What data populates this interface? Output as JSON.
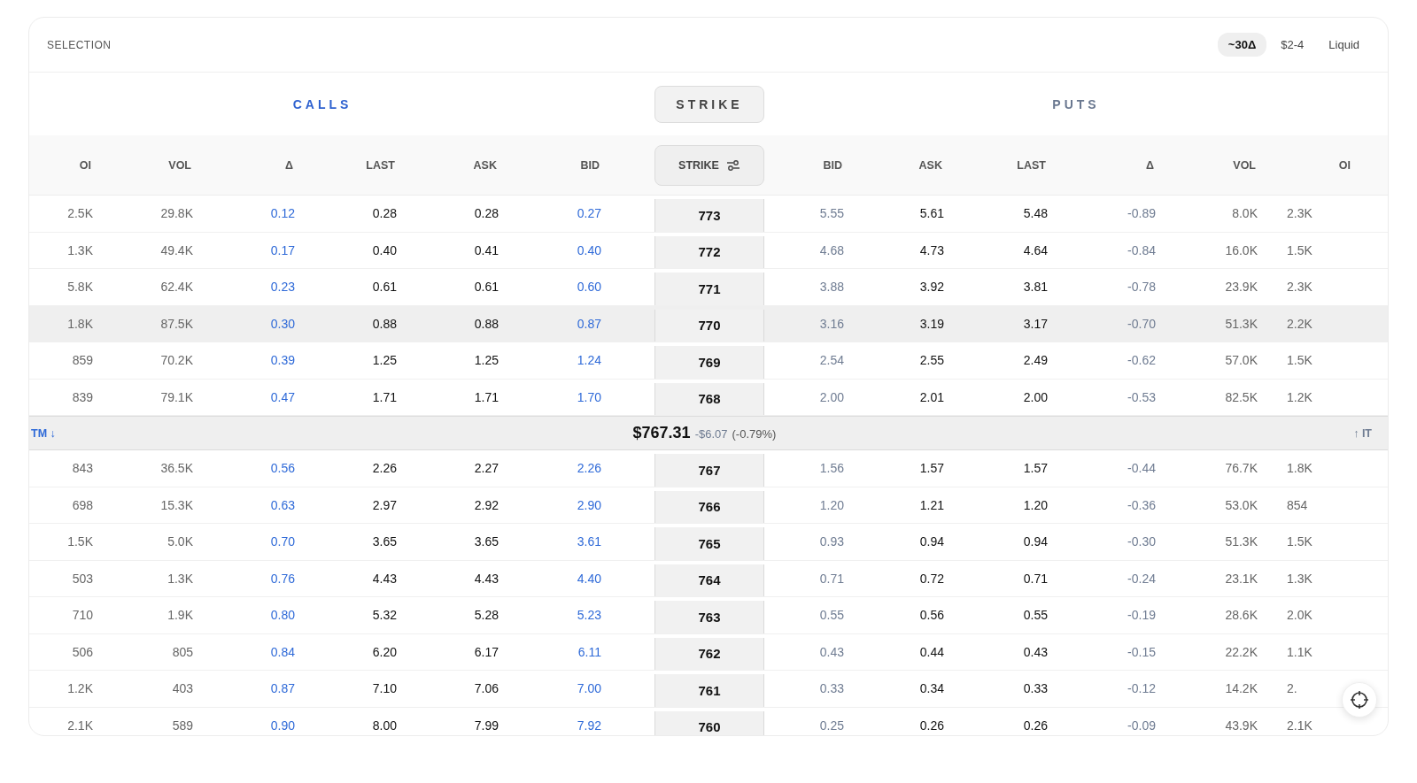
{
  "header": {
    "title": "SELECTION",
    "filters": [
      {
        "label": "~30Δ",
        "selected": true
      },
      {
        "label": "$2-4",
        "selected": false
      },
      {
        "label": "Liquid",
        "selected": false
      }
    ]
  },
  "sides": {
    "calls": "CALLS",
    "strike": "STRIKE",
    "puts": "PUTS"
  },
  "columns": {
    "calls": [
      "OI",
      "VOL",
      "Δ",
      "LAST",
      "ASK",
      "BID"
    ],
    "strike": "STRIKE",
    "puts": [
      "BID",
      "ASK",
      "LAST",
      "Δ",
      "VOL",
      "OI"
    ]
  },
  "rows": [
    {
      "kind": "strike",
      "selected": false,
      "calls": [
        "2.5K",
        "29.8K",
        "0.12",
        "0.28",
        "0.28",
        "0.27"
      ],
      "strike": "773",
      "puts": [
        "5.55",
        "5.61",
        "5.48",
        "-0.89",
        "8.0K",
        "2.3K"
      ]
    },
    {
      "kind": "strike",
      "selected": false,
      "calls": [
        "1.3K",
        "49.4K",
        "0.17",
        "0.40",
        "0.41",
        "0.40"
      ],
      "strike": "772",
      "puts": [
        "4.68",
        "4.73",
        "4.64",
        "-0.84",
        "16.0K",
        "1.5K"
      ]
    },
    {
      "kind": "strike",
      "selected": false,
      "calls": [
        "5.8K",
        "62.4K",
        "0.23",
        "0.61",
        "0.61",
        "0.60"
      ],
      "strike": "771",
      "puts": [
        "3.88",
        "3.92",
        "3.81",
        "-0.78",
        "23.9K",
        "2.3K"
      ]
    },
    {
      "kind": "strike",
      "selected": true,
      "calls": [
        "1.8K",
        "87.5K",
        "0.30",
        "0.88",
        "0.88",
        "0.87"
      ],
      "strike": "770",
      "puts": [
        "3.16",
        "3.19",
        "3.17",
        "-0.70",
        "51.3K",
        "2.2K"
      ]
    },
    {
      "kind": "strike",
      "selected": false,
      "calls": [
        "859",
        "70.2K",
        "0.39",
        "1.25",
        "1.25",
        "1.24"
      ],
      "strike": "769",
      "puts": [
        "2.54",
        "2.55",
        "2.49",
        "-0.62",
        "57.0K",
        "1.5K"
      ]
    },
    {
      "kind": "strike",
      "selected": false,
      "calls": [
        "839",
        "79.1K",
        "0.47",
        "1.71",
        "1.71",
        "1.70"
      ],
      "strike": "768",
      "puts": [
        "2.00",
        "2.01",
        "2.00",
        "-0.53",
        "82.5K",
        "1.2K"
      ]
    },
    {
      "kind": "spot",
      "left": "TM ↓",
      "price": "$767.31",
      "change": "-$6.07",
      "percent": "(-0.79%)",
      "right": "↑ IT"
    },
    {
      "kind": "strike",
      "selected": false,
      "calls": [
        "843",
        "36.5K",
        "0.56",
        "2.26",
        "2.27",
        "2.26"
      ],
      "strike": "767",
      "puts": [
        "1.56",
        "1.57",
        "1.57",
        "-0.44",
        "76.7K",
        "1.8K"
      ]
    },
    {
      "kind": "strike",
      "selected": false,
      "calls": [
        "698",
        "15.3K",
        "0.63",
        "2.97",
        "2.92",
        "2.90"
      ],
      "strike": "766",
      "puts": [
        "1.20",
        "1.21",
        "1.20",
        "-0.36",
        "53.0K",
        "854"
      ]
    },
    {
      "kind": "strike",
      "selected": false,
      "calls": [
        "1.5K",
        "5.0K",
        "0.70",
        "3.65",
        "3.65",
        "3.61"
      ],
      "strike": "765",
      "puts": [
        "0.93",
        "0.94",
        "0.94",
        "-0.30",
        "51.3K",
        "1.5K"
      ]
    },
    {
      "kind": "strike",
      "selected": false,
      "calls": [
        "503",
        "1.3K",
        "0.76",
        "4.43",
        "4.43",
        "4.40"
      ],
      "strike": "764",
      "puts": [
        "0.71",
        "0.72",
        "0.71",
        "-0.24",
        "23.1K",
        "1.3K"
      ]
    },
    {
      "kind": "strike",
      "selected": false,
      "calls": [
        "710",
        "1.9K",
        "0.80",
        "5.32",
        "5.28",
        "5.23"
      ],
      "strike": "763",
      "puts": [
        "0.55",
        "0.56",
        "0.55",
        "-0.19",
        "28.6K",
        "2.0K"
      ]
    },
    {
      "kind": "strike",
      "selected": false,
      "calls": [
        "506",
        "805",
        "0.84",
        "6.20",
        "6.17",
        "6.11"
      ],
      "strike": "762",
      "puts": [
        "0.43",
        "0.44",
        "0.43",
        "-0.15",
        "22.2K",
        "1.1K"
      ]
    },
    {
      "kind": "strike",
      "selected": false,
      "calls": [
        "1.2K",
        "403",
        "0.87",
        "7.10",
        "7.06",
        "7.00"
      ],
      "strike": "761",
      "puts": [
        "0.33",
        "0.34",
        "0.33",
        "-0.12",
        "14.2K",
        "2."
      ]
    },
    {
      "kind": "strike",
      "selected": false,
      "calls": [
        "2.1K",
        "589",
        "0.90",
        "8.00",
        "7.99",
        "7.92"
      ],
      "strike": "760",
      "puts": [
        "0.25",
        "0.26",
        "0.26",
        "-0.09",
        "43.9K",
        "2.1K"
      ]
    }
  ]
}
